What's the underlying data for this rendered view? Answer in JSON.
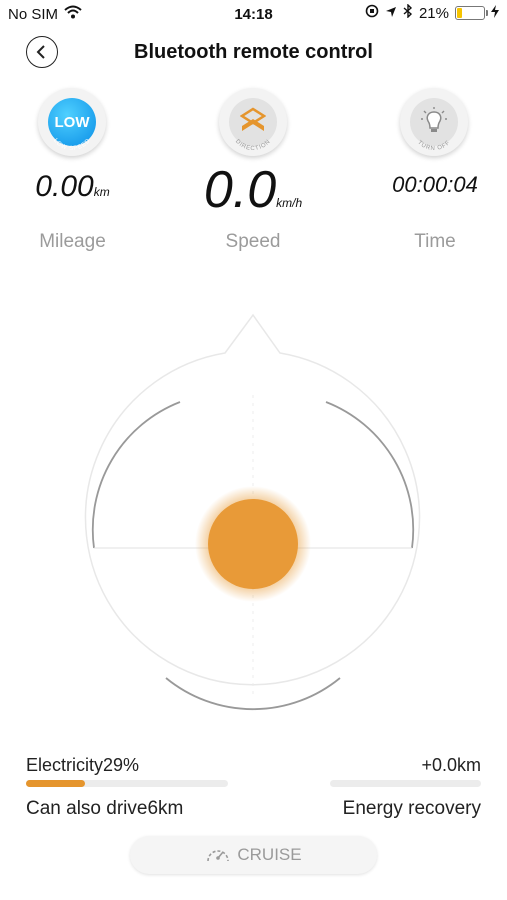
{
  "status_bar": {
    "carrier": "No SIM",
    "time": "14:18",
    "battery_percent": "21%",
    "battery_level": 0.21
  },
  "header": {
    "title": "Bluetooth remote control"
  },
  "modes": {
    "low": {
      "label": "LOW",
      "caption": "LOW SPEED"
    },
    "direction": {
      "caption": "DIRECTION"
    },
    "light": {
      "caption": "TURN OFF"
    }
  },
  "stats": {
    "mileage": {
      "value": "0.00",
      "unit": "km",
      "label": "Mileage"
    },
    "speed": {
      "value": "0.0",
      "unit": "km/h",
      "label": "Speed"
    },
    "time": {
      "value": "00:00:04",
      "label": "Time"
    }
  },
  "battery": {
    "label": "Electricity29%",
    "level": 0.29,
    "range_text": "Can also drive6km"
  },
  "recovery": {
    "value": "+0.0km",
    "label": "Energy recovery",
    "level": 0
  },
  "cruise": {
    "label": "CRUISE"
  },
  "colors": {
    "accent": "#e5952d",
    "low_mode": "#1ea7f0"
  }
}
